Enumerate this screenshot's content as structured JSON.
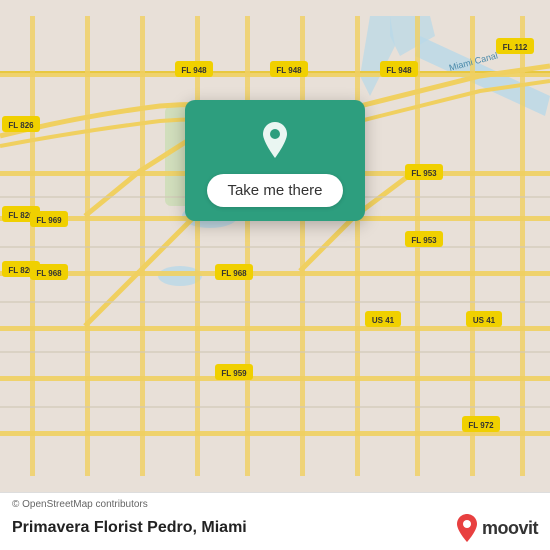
{
  "map": {
    "attribution": "© OpenStreetMap contributors",
    "background_color": "#e8e0d8"
  },
  "popup": {
    "button_label": "Take me there",
    "pin_icon": "location-pin"
  },
  "bottom_bar": {
    "place_name": "Primavera Florist Pedro, Miami",
    "moovit_label": "moovit",
    "moovit_accent_color": "#e84040"
  }
}
